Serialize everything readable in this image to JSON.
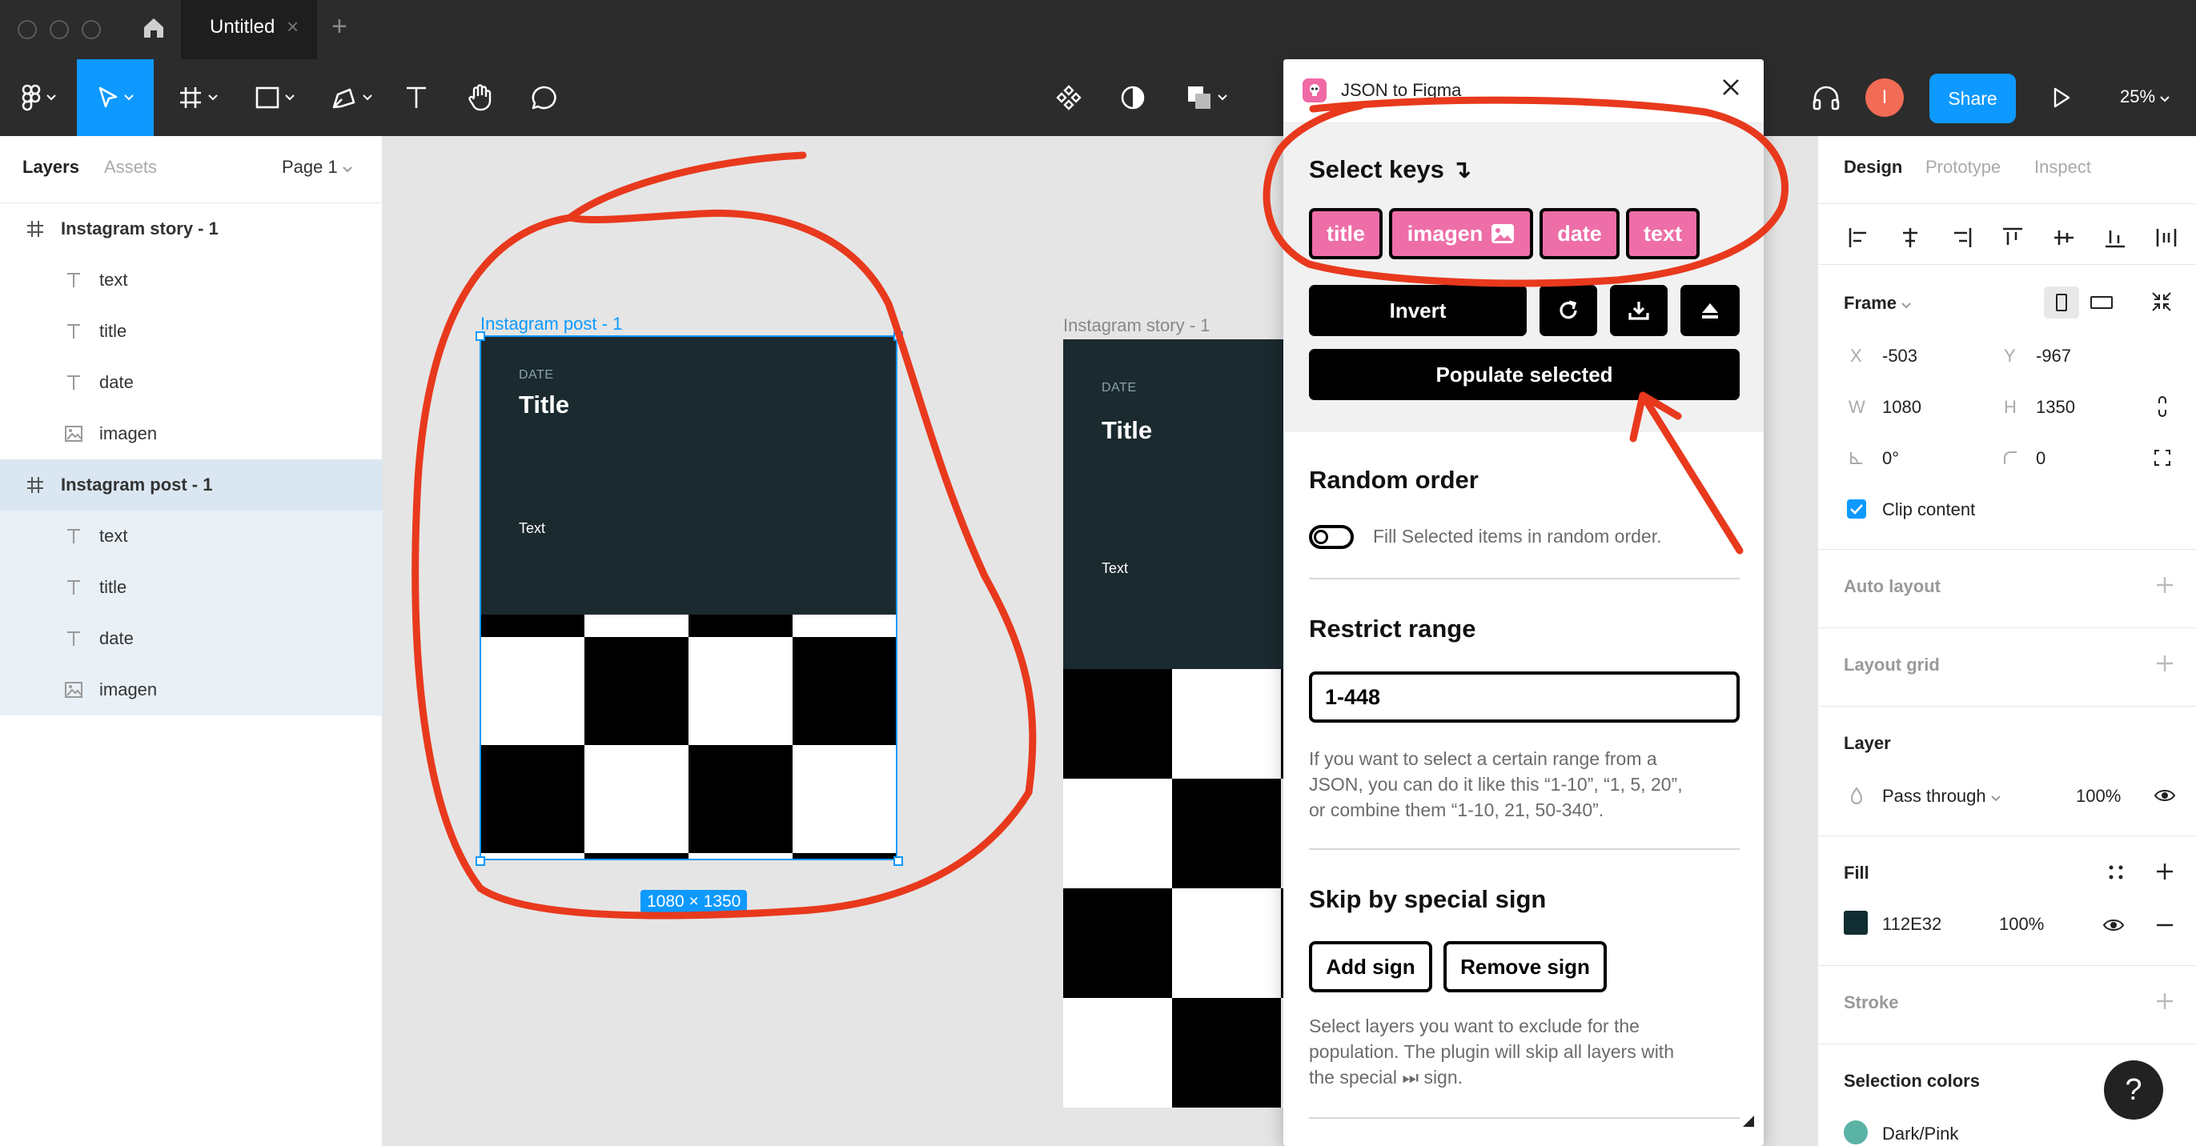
{
  "tab": {
    "title": "Untitled",
    "close": "×",
    "add": "+"
  },
  "toolbar": {
    "avatar_initial": "I",
    "share": "Share",
    "zoom": "25%"
  },
  "left_panel": {
    "tabs": {
      "layers": "Layers",
      "assets": "Assets"
    },
    "page": "Page 1",
    "layers": [
      {
        "name": "Instagram story - 1",
        "type": "frame",
        "depth": 0,
        "selected": false
      },
      {
        "name": "text",
        "type": "text",
        "depth": 1,
        "selected": false
      },
      {
        "name": "title",
        "type": "text",
        "depth": 1,
        "selected": false
      },
      {
        "name": "date",
        "type": "text",
        "depth": 1,
        "selected": false
      },
      {
        "name": "imagen",
        "type": "image",
        "depth": 1,
        "selected": false
      },
      {
        "name": "Instagram post - 1",
        "type": "frame",
        "depth": 0,
        "selected": true
      },
      {
        "name": "text",
        "type": "text",
        "depth": 1,
        "selected": true
      },
      {
        "name": "title",
        "type": "text",
        "depth": 1,
        "selected": true
      },
      {
        "name": "date",
        "type": "text",
        "depth": 1,
        "selected": true
      },
      {
        "name": "imagen",
        "type": "image",
        "depth": 1,
        "selected": true
      }
    ]
  },
  "canvas": {
    "post": {
      "label": "Instagram post - 1",
      "date": "DATE",
      "title": "Title",
      "text": "Text",
      "dimensions": "1080 × 1350"
    },
    "story": {
      "label": "Instagram story - 1",
      "date": "DATE",
      "title": "Title",
      "text": "Text"
    }
  },
  "plugin": {
    "title": "JSON to Figma",
    "select_keys": {
      "heading": "Select keys ↴",
      "chips": [
        "title",
        "imagen",
        "date",
        "text"
      ]
    },
    "invert": "Invert",
    "populate": "Populate selected",
    "random": {
      "heading": "Random order",
      "toggle_label": "Fill Selected items in random order.",
      "enabled": false
    },
    "range": {
      "heading": "Restrict range",
      "value": "1-448",
      "help": [
        "If you want to select a certain range from a",
        "JSON, you can do it like this “1-10”, “1, 5, 20”,",
        "or combine them “1-10, 21, 50-340”."
      ]
    },
    "skip": {
      "heading": "Skip by special sign",
      "add": "Add sign",
      "remove": "Remove sign",
      "help": [
        "Select layers you want to exclude for the",
        "population. The plugin will skip all layers with",
        "the special ⏭ sign."
      ]
    }
  },
  "right_panel": {
    "tabs": {
      "design": "Design",
      "prototype": "Prototype",
      "inspect": "Inspect"
    },
    "frame": {
      "label": "Frame",
      "x": "-503",
      "y": "-967",
      "w": "1080",
      "h": "1350",
      "rotation": "0°",
      "radius": "0",
      "clip_label": "Clip content",
      "clip": true
    },
    "auto_layout": "Auto layout",
    "layout_grid": "Layout grid",
    "layer": {
      "label": "Layer",
      "blend": "Pass through",
      "opacity": "100%"
    },
    "fill": {
      "label": "Fill",
      "hex": "112E32",
      "opacity": "100%",
      "color": "#112e32"
    },
    "stroke": "Stroke",
    "selection_colors": {
      "label": "Selection colors",
      "name": "Dark/Pink",
      "color": "#5bb3a5"
    },
    "help": "?"
  },
  "colors": {
    "accent": "#0d99ff",
    "chip": "#ee6ea8",
    "frame_bg": "#1b2a2f",
    "annotation": "#e8391d"
  }
}
